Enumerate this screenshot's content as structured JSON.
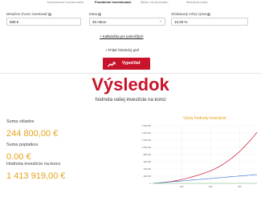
{
  "tabs": [
    {
      "label": "Jednorazové investovanie",
      "active": false
    },
    {
      "label": "Pravidelné investovanie",
      "active": true
    },
    {
      "label": "Milión na dôchodku",
      "active": false
    },
    {
      "label": "Mesačná renta",
      "active": false
    }
  ],
  "form": {
    "monthly_label": "Mesačne chcem investovať",
    "monthly_value": "680 €",
    "period_label": "Doba",
    "period_value": "30 rokov",
    "return_label": "Očakávaný ročný výnos",
    "return_value": "10,00 %",
    "costs_link": "+ Kalkulačka pre pokročilých",
    "chart_link": "+ Pridať historický graf",
    "calc_button": "Vypočítať"
  },
  "result": {
    "title": "Výsledok",
    "subtitle": "hodnota vašej investície na konci",
    "deposits_label": "Suma vkladov",
    "deposits_value": "244 800,00 €",
    "fees_label": "Suma poplatkov",
    "fees_value": "0.00 €",
    "final_label": "Hodnota investície na konci",
    "final_value": "1 413 919,00 €"
  },
  "chart_data": {
    "type": "line",
    "title": "Vývoj hodnoty investície",
    "xlabel": "",
    "ylabel": "",
    "x_ticks": [
      "100",
      "200",
      "300"
    ],
    "y_ticks": [
      "0",
      "200 000",
      "400 000",
      "600 000",
      "800 000",
      "1 000 000",
      "1 200 000",
      "1 400 000",
      "1 600 000"
    ],
    "xlim": [
      0,
      360
    ],
    "ylim": [
      0,
      1600000
    ],
    "series": [
      {
        "color": "#c8142a",
        "x": [
          0,
          30,
          60,
          90,
          120,
          150,
          180,
          210,
          240,
          270,
          300,
          330,
          360
        ],
        "values": [
          0,
          21600,
          46000,
          88000,
          143000,
          212000,
          290000,
          380000,
          510000,
          680000,
          880000,
          1130000,
          1413919
        ]
      },
      {
        "color": "#4a7fd4",
        "x": [
          0,
          60,
          120,
          180,
          240,
          300,
          360
        ],
        "values": [
          0,
          40800,
          81600,
          122400,
          163200,
          204000,
          244800
        ]
      },
      {
        "color": "#9fd29f",
        "x": [
          0,
          360
        ],
        "values": [
          0,
          0
        ]
      }
    ],
    "grid": true,
    "title_color": "#e5a219"
  }
}
